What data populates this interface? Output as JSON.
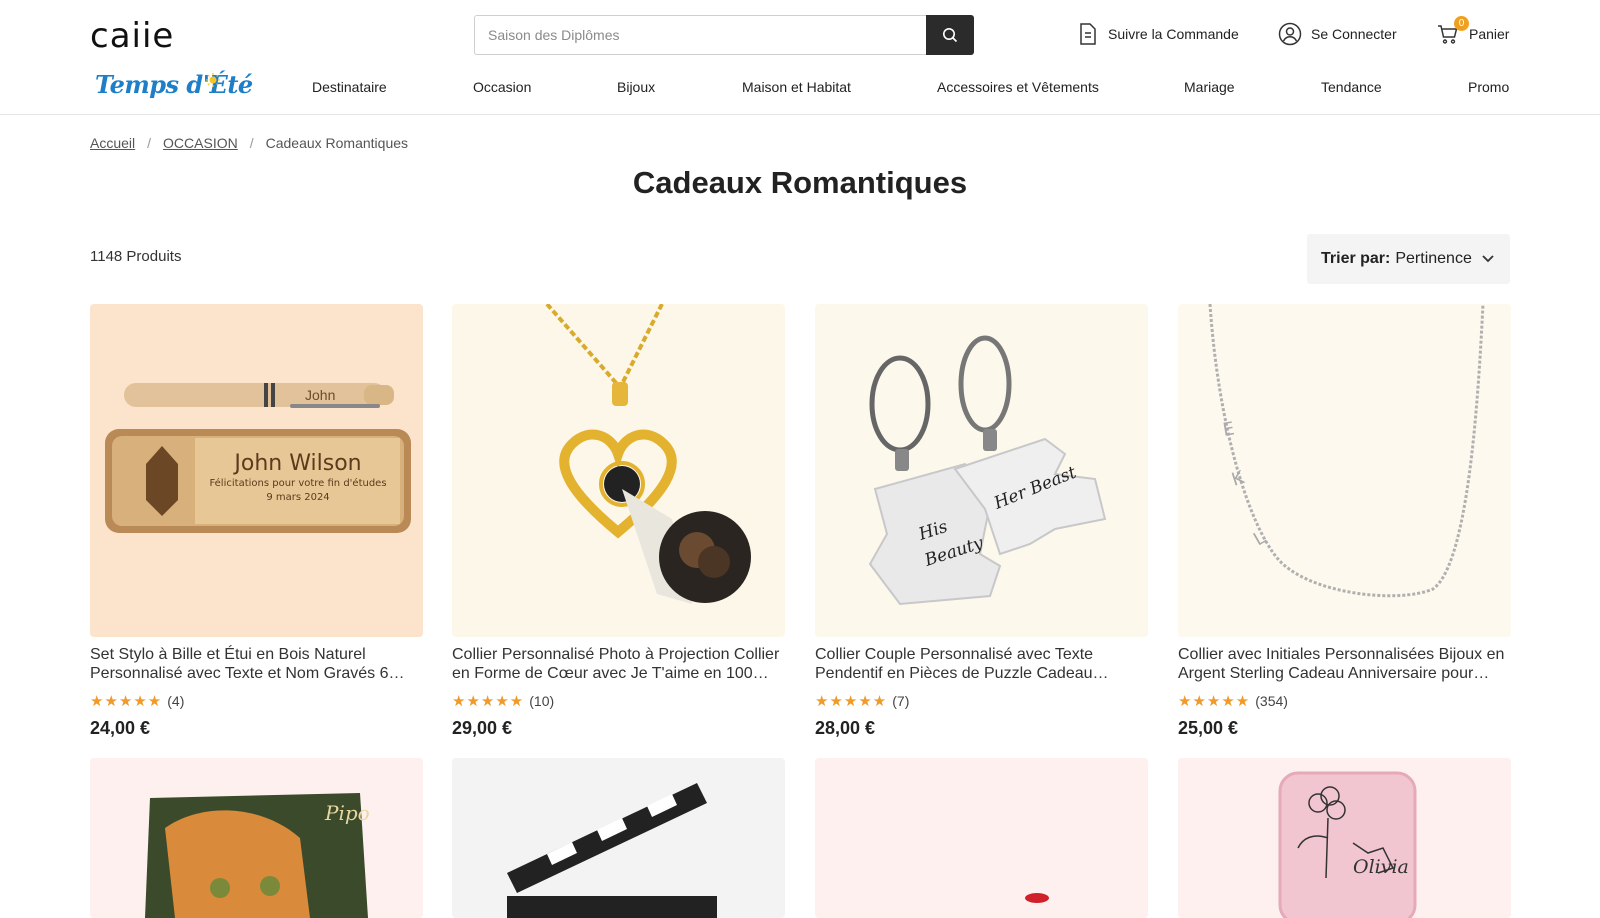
{
  "header": {
    "logo_text": "caiie",
    "search_placeholder": "Saison des Diplômes",
    "track_order": "Suivre la Commande",
    "login": "Se Connecter",
    "cart": "Panier",
    "cart_count": "0"
  },
  "promo_logo": "Temps d'Été",
  "nav": [
    "Destinataire",
    "Occasion",
    "Bijoux",
    "Maison et Habitat",
    "Accessoires et Vêtements",
    "Mariage",
    "Tendance",
    "Promo"
  ],
  "breadcrumb": {
    "home": "Accueil",
    "section": "OCCASION",
    "current": "Cadeaux Romantiques"
  },
  "page_title": "Cadeaux Romantiques",
  "product_count": "1148 Produits",
  "sort": {
    "label": "Trier par:",
    "value": "Pertinence"
  },
  "products": [
    {
      "name": "Set Stylo à Bille et Étui en Bois Naturel Personnalisé avec Texte et Nom Gravés 6…",
      "stars": "★★★★★",
      "reviews": "(4)",
      "price": "24,00 €",
      "img_text": {
        "pen_name": "John",
        "box_name": "John Wilson",
        "box_line1": "Félicitations pour votre fin d'études",
        "box_line2": "9 mars 2024"
      },
      "bg": "#fbe3cc"
    },
    {
      "name": "Collier Personnalisé Photo à Projection Collier en Forme de Cœur avec Je T'aime en 100…",
      "stars": "★★★★★",
      "reviews": "(10)",
      "price": "29,00 €",
      "bg": "#fdf7ea"
    },
    {
      "name": "Collier Couple Personnalisé avec Texte Pendentif en Pièces de Puzzle Cadeau…",
      "stars": "★★★★★",
      "reviews": "(7)",
      "price": "28,00 €",
      "img_text": {
        "left": "His Beauty",
        "right": "Her Beast"
      },
      "bg": "#fdf8ec"
    },
    {
      "name": "Collier avec Initiales Personnalisées Bijoux en Argent Sterling Cadeau Anniversaire pour…",
      "stars": "★★★★★",
      "reviews": "(354)",
      "price": "25,00 €",
      "bg": "#fdf9ef"
    }
  ],
  "products_row2": [
    {
      "bg": "#fdf0ef",
      "img_text": "Pipo"
    },
    {
      "bg": "#f3f3f3"
    },
    {
      "bg": "#fdf0ef"
    },
    {
      "bg": "#fdf0ef",
      "img_text": "Olivia"
    }
  ]
}
